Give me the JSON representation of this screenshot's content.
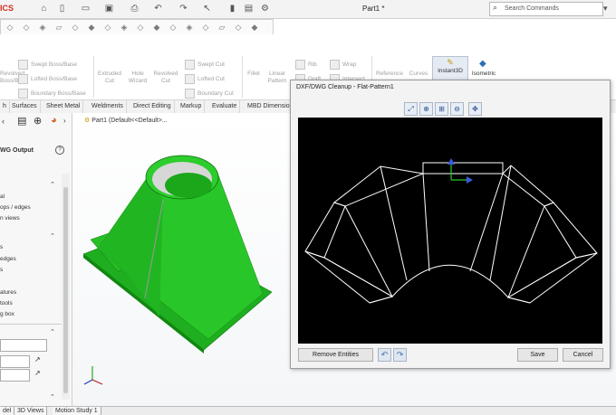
{
  "window": {
    "logo": "ICS",
    "document_title": "Part1 *",
    "search_placeholder": "Search Commands"
  },
  "ribbon": {
    "items": {
      "revolved_boss": "Revolved\nBoss/Base",
      "swept_boss": "Swept Boss/Base",
      "lofted_boss": "Lofted Boss/Base",
      "boundary_boss": "Boundary Boss/Base",
      "extruded_cut": "Extruded\nCut",
      "hole_wizard": "Hole\nWizard",
      "revolved_cut": "Revolved\nCut",
      "swept_cut": "Swept Cut",
      "lofted_cut": "Lofted Cut",
      "boundary_cut": "Boundary Cut",
      "fillet": "Fillet",
      "linear_pattern": "Linear\nPattern",
      "rib": "Rib",
      "draft": "Draft",
      "wrap": "Wrap",
      "intersect": "Intersect",
      "reference": "Reference",
      "curves": "Curves",
      "instant3d": "Instant3D",
      "isometric": "Isometric"
    }
  },
  "tabs": [
    "h",
    "Surfaces",
    "Sheet Metal",
    "Weldments",
    "Direct Editing",
    "Markup",
    "Evaluate",
    "MBD Dimensions"
  ],
  "left_panel": {
    "title": "WG Output",
    "help": "?",
    "items": [
      "al",
      "ops / edges",
      "n views",
      "s",
      "edges",
      "s",
      "atures",
      "tools",
      "g box"
    ]
  },
  "feature_tree": {
    "part": "Part1  (Default<<Default>..."
  },
  "bottom_tabs": [
    "del",
    "3D Views",
    "Motion Study 1"
  ],
  "dialog": {
    "title": "DXF/DWG Cleanup - Flat-Pattern1",
    "remove_entities": "Remove Entities",
    "save": "Save",
    "cancel": "Cancel"
  },
  "colors": {
    "model_green": "#22bb22",
    "canvas_bg": "#000000",
    "accent_blue": "#2a4d8f"
  }
}
